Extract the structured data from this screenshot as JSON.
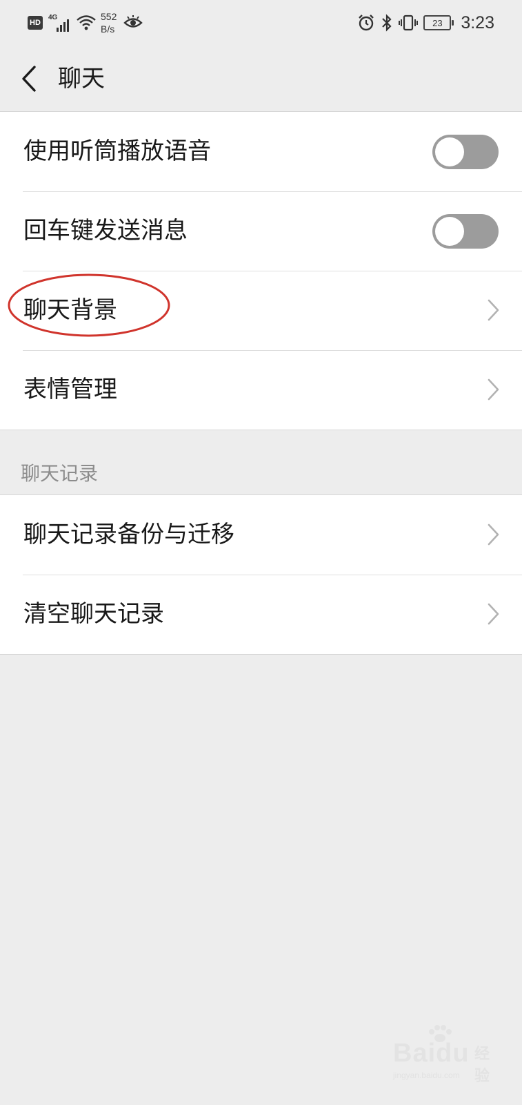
{
  "status_bar": {
    "hd": "HD",
    "network": "4G",
    "speed_value": "552",
    "speed_unit": "B/s",
    "battery": "23",
    "time": "3:23",
    "icons": [
      "signal-icon",
      "wifi-icon",
      "eye-icon",
      "alarm-icon",
      "bluetooth-icon",
      "vibrate-icon",
      "battery-icon"
    ]
  },
  "nav": {
    "title": "聊天",
    "back_icon": "chevron-left-icon"
  },
  "group1": {
    "rows": [
      {
        "label": "使用听筒播放语音",
        "control": "toggle",
        "on": false
      },
      {
        "label": "回车键发送消息",
        "control": "toggle",
        "on": false
      },
      {
        "label": "聊天背景",
        "control": "chevron",
        "highlighted": true
      },
      {
        "label": "表情管理",
        "control": "chevron"
      }
    ]
  },
  "section_chat_history": {
    "header": "聊天记录",
    "rows": [
      {
        "label": "聊天记录备份与迁移",
        "control": "chevron"
      },
      {
        "label": "清空聊天记录",
        "control": "chevron"
      }
    ]
  },
  "colors": {
    "background": "#ededed",
    "card": "#ffffff",
    "toggle_off": "#9c9c9c",
    "annotation": "#d0342c",
    "section_header": "#8c8c8c"
  },
  "watermark": {
    "brand": "Bai",
    "brand2": "du",
    "jingyan": "经验",
    "url": "jingyan.baidu.com"
  }
}
